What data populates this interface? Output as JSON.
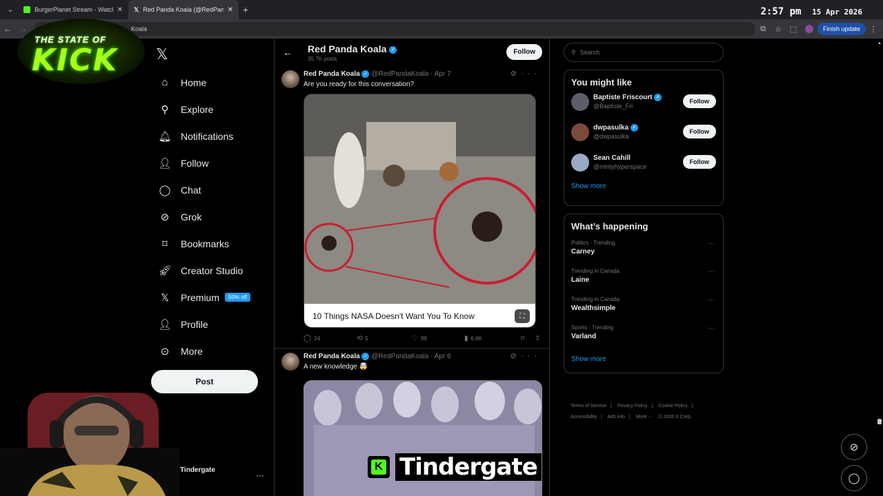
{
  "browser": {
    "tabs": [
      {
        "title": "BurgerPlanet Stream - Watch Li",
        "favicon_color": "#53fc18"
      },
      {
        "title": "Red Panda Koala (@RedPandaK",
        "favicon_color": "#ffffff"
      }
    ],
    "address_text": "Koala",
    "finish_update_label": "Finish update",
    "clock_time": "2:57 pm",
    "clock_date": "15 Apr 2026"
  },
  "overlay": {
    "logo_line1": "THE STATE OF",
    "logo_line2": "KICK",
    "caption_k": "K",
    "caption_text": "Tindergate"
  },
  "sidebar": {
    "items": [
      {
        "label": "Home",
        "icon": "home-icon"
      },
      {
        "label": "Explore",
        "icon": "search-icon"
      },
      {
        "label": "Notifications",
        "icon": "bell-icon"
      },
      {
        "label": "Follow",
        "icon": "add-user-icon"
      },
      {
        "label": "Chat",
        "icon": "chat-icon"
      },
      {
        "label": "Grok",
        "icon": "grok-icon"
      },
      {
        "label": "Bookmarks",
        "icon": "bookmark-icon"
      },
      {
        "label": "Creator Studio",
        "icon": "rocket-icon"
      },
      {
        "label": "Premium",
        "icon": "x-icon",
        "badge": "50% off"
      },
      {
        "label": "Profile",
        "icon": "person-icon"
      },
      {
        "label": "More",
        "icon": "more-circle-icon"
      }
    ],
    "post_label": "Post",
    "account_name": "Tindergate"
  },
  "profile_header": {
    "name": "Red Panda Koala",
    "posts_count": "35.7K posts",
    "follow_label": "Follow"
  },
  "tweets": [
    {
      "name": "Red Panda Koala",
      "handle": "@RedPandaKoala",
      "date": "· Apr 7",
      "text": "Are you ready for this conversation?",
      "card_title": "10 Things NASA Doesn't Want You To Know",
      "replies": "24",
      "reposts": "5",
      "likes": "99",
      "views": "6.6K"
    },
    {
      "name": "Red Panda Koala",
      "handle": "@RedPandaKoala",
      "date": "· Apr 6",
      "text": "A new knowledge 🤯"
    }
  ],
  "right": {
    "search_placeholder": "Search",
    "you_might_like_title": "You might like",
    "suggestions": [
      {
        "name": "Baptiste Friscourt",
        "handle": "@Baptiste_Fri",
        "follow": "Follow",
        "avatar_color": "#5b5f6b"
      },
      {
        "name": "dwpasulka",
        "handle": "@dwpasulka",
        "follow": "Follow",
        "avatar_color": "#7a4a3a"
      },
      {
        "name": "Sean Cahill",
        "handle": "@mintyhyperspace",
        "follow": "Follow",
        "avatar_color": "#9aa9c4"
      }
    ],
    "show_more": "Show more",
    "whats_happening_title": "What’s happening",
    "trends": [
      {
        "context": "Politics · Trending",
        "topic": "Carney"
      },
      {
        "context": "Trending in Canada",
        "topic": "Laine"
      },
      {
        "context": "Trending in Canada",
        "topic": "Wealthsimple"
      },
      {
        "context": "Sports · Trending",
        "topic": "Varland"
      }
    ],
    "show_more_2": "Show more",
    "footer": [
      "Terms of Service",
      "|",
      "Privacy Policy",
      "|",
      "Cookie Policy",
      "|",
      "Accessibility",
      "|",
      "Ads info",
      "|",
      "More ···",
      "© 2026 X Corp."
    ]
  }
}
